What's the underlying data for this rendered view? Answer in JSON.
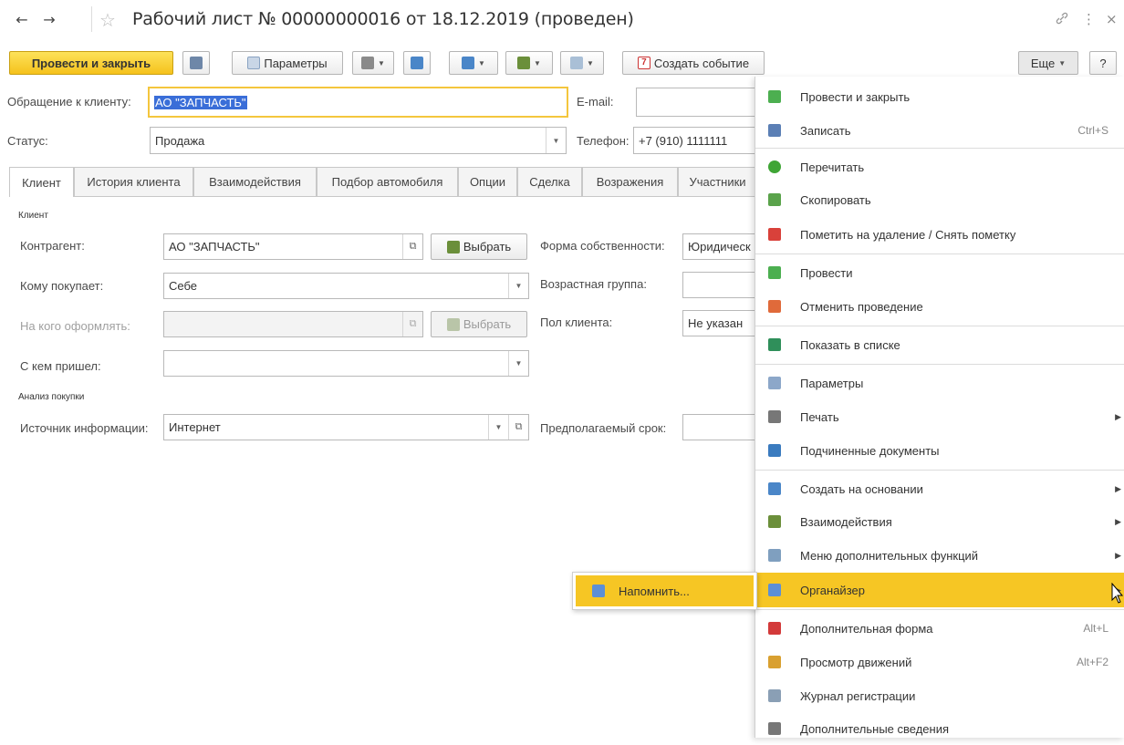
{
  "window": {
    "title": "Рабочий лист № 00000000016 от 18.12.2019 (проведен)",
    "back_glyph": "←",
    "forward_glyph": "→",
    "star_glyph": "☆",
    "link_glyph": "🔗",
    "more_glyph": "⋮",
    "close_glyph": "×"
  },
  "toolbar": {
    "post_close_label": "Провести и закрыть",
    "params_label": "Параметры",
    "create_event_label": "Создать событие",
    "create_event_day": "7",
    "more_label": "Еще",
    "help_label": "?"
  },
  "header": {
    "client_request_label": "Обращение к клиенту:",
    "client_request_value": "АО \"ЗАПЧАСТЬ\"",
    "email_label": "E-mail:",
    "email_value": "",
    "status_label": "Статус:",
    "status_value": "Продажа",
    "phone_label": "Телефон:",
    "phone_value": "+7 (910) 1111111"
  },
  "tabs": [
    {
      "label": "Клиент"
    },
    {
      "label": "История клиента"
    },
    {
      "label": "Взаимодействия"
    },
    {
      "label": "Подбор автомобиля"
    },
    {
      "label": "Опции"
    },
    {
      "label": "Сделка"
    },
    {
      "label": "Возражения"
    },
    {
      "label": "Участники"
    }
  ],
  "client_section": {
    "title": "Клиент",
    "counterparty_label": "Контрагент:",
    "counterparty_value": "АО \"ЗАПЧАСТЬ\"",
    "select_label": "Выбрать",
    "buys_for_label": "Кому покупает:",
    "buys_for_value": "Себе",
    "register_to_label": "На кого оформлять:",
    "register_to_value": "",
    "select_label_disabled": "Выбрать",
    "came_with_label": "С кем пришел:",
    "came_with_value": "",
    "ownership_label": "Форма собственности:",
    "ownership_value": "Юридическ",
    "age_group_label": "Возрастная группа:",
    "age_group_value": "",
    "gender_label": "Пол клиента:",
    "gender_value": "Не указан"
  },
  "purchase_section": {
    "title": "Анализ покупки",
    "info_source_label": "Источник информации:",
    "info_source_value": "Интернет",
    "expected_term_label": "Предполагаемый срок:",
    "expected_term_value": ""
  },
  "menu": {
    "items": [
      {
        "label": "Провести и закрыть",
        "shortcut": "",
        "arrow": "",
        "icon_color": "#4caf50"
      },
      {
        "label": "Записать",
        "shortcut": "Ctrl+S",
        "arrow": "",
        "icon_color": "#5b7fb5"
      },
      {
        "label": "Перечитать",
        "shortcut": "",
        "arrow": "",
        "icon_color": "#3fa535"
      },
      {
        "label": "Скопировать",
        "shortcut": "",
        "arrow": "",
        "icon_color": "#5aa34b"
      },
      {
        "label": "Пометить на удаление / Снять пометку",
        "shortcut": "",
        "arrow": "",
        "icon_color": "#d9413a"
      },
      {
        "label": "Провести",
        "shortcut": "",
        "arrow": "",
        "icon_color": "#4caf50"
      },
      {
        "label": "Отменить проведение",
        "shortcut": "",
        "arrow": "",
        "icon_color": "#e06a3a"
      },
      {
        "label": "Показать в списке",
        "shortcut": "",
        "arrow": "",
        "icon_color": "#2f8f5a"
      },
      {
        "label": "Параметры",
        "shortcut": "",
        "arrow": "",
        "icon_color": "#8ca7c9"
      },
      {
        "label": "Печать",
        "shortcut": "",
        "arrow": "▶",
        "icon_color": "#777777"
      },
      {
        "label": "Подчиненные документы",
        "shortcut": "",
        "arrow": "",
        "icon_color": "#3a7bbf"
      },
      {
        "label": "Создать на основании",
        "shortcut": "",
        "arrow": "▶",
        "icon_color": "#4a86c8"
      },
      {
        "label": "Взаимодействия",
        "shortcut": "",
        "arrow": "▶",
        "icon_color": "#6b8f3a"
      },
      {
        "label": "Меню дополнительных функций",
        "shortcut": "",
        "arrow": "▶",
        "icon_color": "#7f9fbf"
      },
      {
        "label": "Органайзер",
        "shortcut": "",
        "arrow": "▶",
        "icon_color": "#5c8fd6"
      },
      {
        "label": "Дополнительная форма",
        "shortcut": "Alt+L",
        "arrow": "",
        "icon_color": "#d33a3a"
      },
      {
        "label": "Просмотр движений",
        "shortcut": "Alt+F2",
        "arrow": "",
        "icon_color": "#d9a030"
      },
      {
        "label": "Журнал регистрации",
        "shortcut": "",
        "arrow": "",
        "icon_color": "#8a9fb5"
      },
      {
        "label": "Дополнительные сведения",
        "shortcut": "",
        "arrow": "",
        "icon_color": "#777777"
      }
    ]
  },
  "submenu": {
    "item_label": "Напомнить..."
  },
  "colors": {
    "accent_yellow": "#f6c624",
    "selection_blue": "#3a6ed8"
  }
}
